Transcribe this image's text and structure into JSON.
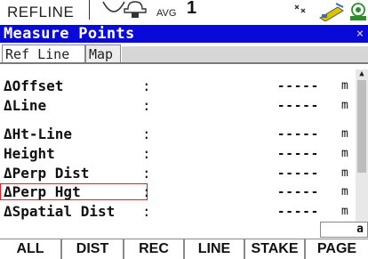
{
  "status": {
    "mode": "REFLINE",
    "avg_label": "AVG",
    "avg_value": "1",
    "icons": [
      "satellite-icon",
      "radio-icon",
      "instrument-icon",
      "battery-icon"
    ]
  },
  "window": {
    "title": "Measure Points",
    "close_glyph": "×"
  },
  "tabs": [
    {
      "label": "Ref Line",
      "active": true
    },
    {
      "label": "Map",
      "active": false
    }
  ],
  "fields": [
    {
      "label": "ΔOffset",
      "value": "-----",
      "unit": "m"
    },
    {
      "label": "ΔLine",
      "value": "-----",
      "unit": "m"
    },
    {
      "label": "ΔHt-Line",
      "value": "-----",
      "unit": "m"
    },
    {
      "label": "Height",
      "value": "-----",
      "unit": "m"
    },
    {
      "label": "ΔPerp Dist",
      "value": "-----",
      "unit": "m"
    },
    {
      "label": "ΔPerp Hgt",
      "value": "-----",
      "unit": "m"
    },
    {
      "label": "ΔSpatial Dist",
      "value": "-----",
      "unit": "m"
    }
  ],
  "colon": ":",
  "input_mode": "a",
  "function_keys": [
    "ALL",
    "DIST",
    "REC",
    "LINE",
    "STAKE",
    "PAGE"
  ],
  "colors": {
    "title_bar": "#0a0ad8",
    "focus_border": "#e02020",
    "function_bar": "#8a8a8a"
  }
}
